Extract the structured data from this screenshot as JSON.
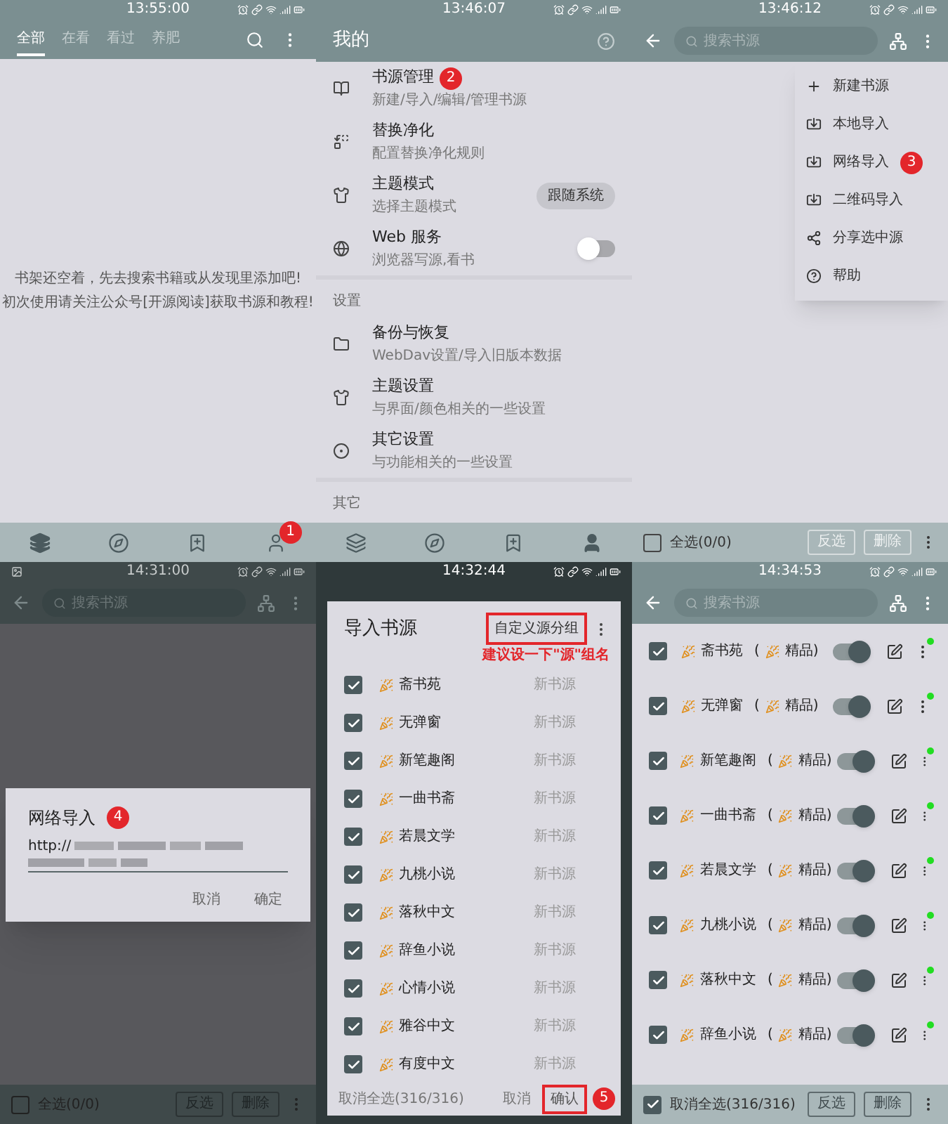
{
  "bookshelf_screen": {
    "time": "13:55:00",
    "tabs": [
      {
        "label": "全部",
        "selected": true
      },
      {
        "label": "在看",
        "selected": false
      },
      {
        "label": "看过",
        "selected": false
      },
      {
        "label": "养肥",
        "selected": false
      }
    ],
    "empty_message": [
      "书架还空着，先去搜索书籍或从发现里添加吧!",
      "初次使用请关注公众号[开源阅读]获取书源和教程!"
    ],
    "nav": [
      {
        "selected": true
      },
      {
        "selected": false
      },
      {
        "selected": false
      },
      {
        "selected": false,
        "badge": "1"
      }
    ]
  },
  "my_screen": {
    "time": "13:46:07",
    "title": "我的",
    "groups": [
      {
        "items": [
          {
            "kind": "link",
            "title": "书源管理",
            "subtitle": "新建/导入/编辑/管理书源",
            "badge": "2"
          },
          {
            "kind": "link",
            "title": "替换净化",
            "subtitle": "配置替换净化规则"
          },
          {
            "kind": "chip",
            "title": "主题模式",
            "subtitle": "选择主题模式",
            "value": "跟随系统"
          },
          {
            "kind": "switch",
            "title": "Web 服务",
            "subtitle": "浏览器写源,看书",
            "on": false
          }
        ]
      },
      {
        "heading": "设置",
        "items": [
          {
            "kind": "link",
            "title": "备份与恢复",
            "subtitle": "WebDav设置/导入旧版本数据"
          },
          {
            "kind": "link",
            "title": "主题设置",
            "subtitle": "与界面/颜色相关的一些设置"
          },
          {
            "kind": "link",
            "title": "其它设置",
            "subtitle": "与功能相关的一些设置"
          }
        ]
      },
      {
        "heading": "其它"
      }
    ],
    "nav": [
      {
        "selected": false
      },
      {
        "selected": false
      },
      {
        "selected": false
      },
      {
        "selected": true
      }
    ]
  },
  "source_menu_screen": {
    "time": "13:46:12",
    "search_placeholder": "搜索书源",
    "menu": [
      {
        "label": "新建书源"
      },
      {
        "label": "本地导入"
      },
      {
        "label": "网络导入",
        "badge": "3"
      },
      {
        "label": "二维码导入"
      },
      {
        "label": "分享选中源"
      },
      {
        "label": "帮助"
      }
    ],
    "footer": {
      "select_all": "全选(0/0)",
      "checked": false,
      "invert": "反选",
      "delete": "删除",
      "disabled": true
    }
  },
  "network_import_screen": {
    "time": "14:31:00",
    "search_placeholder": "搜索书源",
    "dialog": {
      "title": "网络导入",
      "badge": "4",
      "value": "http://",
      "cancel": "取消",
      "ok": "确定"
    },
    "footer": {
      "select_all": "全选(0/0)",
      "checked": false,
      "invert": "反选",
      "delete": "删除",
      "disabled": true
    }
  },
  "import_dialog_screen": {
    "time": "14:32:44",
    "title": "导入书源",
    "group_button": "自定义源分组",
    "annotation": "建议设一下\"源\"组名",
    "rows": [
      {
        "name": "斋书苑",
        "status": "新书源",
        "checked": true
      },
      {
        "name": "无弹窗",
        "status": "新书源",
        "checked": true
      },
      {
        "name": "新笔趣阁",
        "status": "新书源",
        "checked": true
      },
      {
        "name": "一曲书斋",
        "status": "新书源",
        "checked": true
      },
      {
        "name": "若晨文学",
        "status": "新书源",
        "checked": true
      },
      {
        "name": "九桃小说",
        "status": "新书源",
        "checked": true
      },
      {
        "name": "落秋中文",
        "status": "新书源",
        "checked": true
      },
      {
        "name": "辞鱼小说",
        "status": "新书源",
        "checked": true
      },
      {
        "name": "心情小说",
        "status": "新书源",
        "checked": true
      },
      {
        "name": "雅谷中文",
        "status": "新书源",
        "checked": true
      },
      {
        "name": "有度中文",
        "status": "新书源",
        "checked": true
      }
    ],
    "footer": {
      "toggle_all": "取消全选(316/316)",
      "cancel": "取消",
      "confirm": "确认",
      "badge": "5"
    }
  },
  "source_list_screen": {
    "time": "14:34:53",
    "search_placeholder": "搜索书源",
    "rows": [
      {
        "name": "斋书苑",
        "group": [
          "(",
          "精品)"
        ],
        "checked": true,
        "enabled": true,
        "color": "#22dd22"
      },
      {
        "name": "无弹窗",
        "group": [
          "(",
          "精品)"
        ],
        "checked": true,
        "enabled": true,
        "color": "#22dd22"
      },
      {
        "name": "新笔趣阁",
        "group": [
          "(",
          "精品)"
        ],
        "checked": true,
        "enabled": true,
        "color": "#22dd22"
      },
      {
        "name": "一曲书斋",
        "group": [
          "(",
          "精品)"
        ],
        "checked": true,
        "enabled": true,
        "color": "#22dd22"
      },
      {
        "name": "若晨文学",
        "group": [
          "(",
          "精品)"
        ],
        "checked": true,
        "enabled": true,
        "color": "#22dd22"
      },
      {
        "name": "九桃小说",
        "group": [
          "(",
          "精品)"
        ],
        "checked": true,
        "enabled": true,
        "color": "#22dd22"
      },
      {
        "name": "落秋中文",
        "group": [
          "(",
          "精品)"
        ],
        "checked": true,
        "enabled": true,
        "color": "#22dd22"
      },
      {
        "name": "辞鱼小说",
        "group": [
          "(",
          "精品)"
        ],
        "checked": true,
        "enabled": true,
        "color": "#22dd22"
      }
    ],
    "footer": {
      "select_all": "取消全选(316/316)",
      "checked": true,
      "invert": "反选",
      "delete": "删除",
      "disabled": false
    }
  }
}
